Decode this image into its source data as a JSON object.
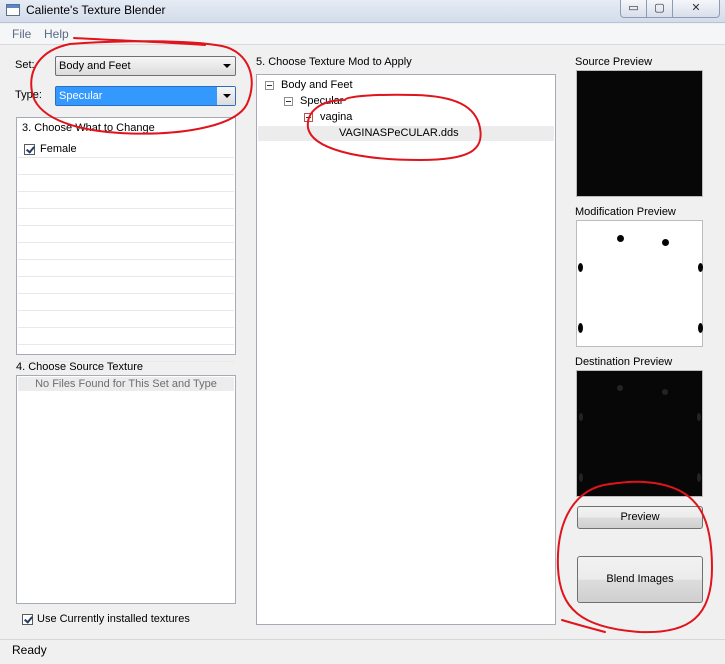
{
  "window": {
    "title": "Caliente's Texture Blender",
    "controls": {
      "minimize": "▭",
      "maximize": "▢",
      "close": "✕"
    }
  },
  "menu": {
    "file": "File",
    "help": "Help"
  },
  "filters": {
    "set_label": "Set:",
    "set_value": "Body and Feet",
    "type_label": "Type:",
    "type_value": "Specular"
  },
  "change_panel": {
    "title": "3. Choose What to Change",
    "items": [
      {
        "label": "Female",
        "checked": true
      }
    ]
  },
  "source_panel": {
    "title": "4. Choose Source Texture",
    "empty_text": "No Files Found for This Set and Type"
  },
  "use_installed": {
    "label": "Use Currently installed textures",
    "checked": true
  },
  "mod_panel": {
    "title": "5. Choose Texture Mod to Apply",
    "tree": {
      "root": "Body and Feet",
      "child": "Specular",
      "grandchild": "vagina",
      "leaf": "VAGINASPeCULAR.dds"
    }
  },
  "previews": {
    "source_label": "Source Preview",
    "modification_label": "Modification Preview",
    "destination_label": "Destination Preview"
  },
  "buttons": {
    "preview": "Preview",
    "blend": "Blend Images"
  },
  "status": {
    "text": "Ready"
  },
  "colors": {
    "annotation_red": "#e0141c",
    "selection_blue": "#3399ff"
  }
}
